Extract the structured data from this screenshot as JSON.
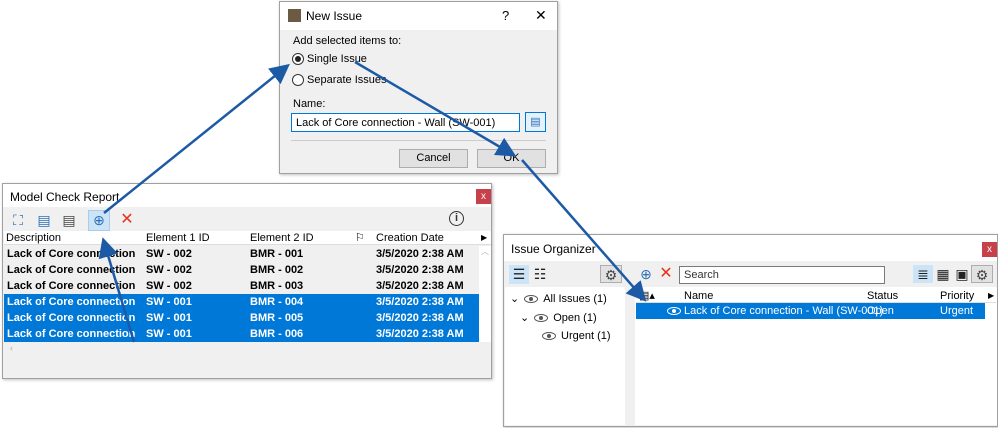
{
  "new_issue": {
    "title": "New Issue",
    "help": "?",
    "close": "✕",
    "prompt": "Add selected items to:",
    "options": [
      "Single Issue",
      "Separate Issues"
    ],
    "selected": "Single Issue",
    "name_label": "Name:",
    "name_value": "Lack of Core connection - Wall (SW-001)",
    "cancel": "Cancel",
    "ok": "OK"
  },
  "report": {
    "title": "Model Check Report",
    "close": "x",
    "info": "i",
    "columns": [
      "Description",
      "Element 1 ID",
      "Element 2 ID",
      "Creation Date"
    ],
    "rows": [
      {
        "d": "Lack of Core connection",
        "e1": "SW - 002",
        "e2": "BMR - 001",
        "date": "3/5/2020 2:38 AM",
        "selected": false
      },
      {
        "d": "Lack of Core connection",
        "e1": "SW - 002",
        "e2": "BMR - 002",
        "date": "3/5/2020 2:38 AM",
        "selected": false
      },
      {
        "d": "Lack of Core connection",
        "e1": "SW - 002",
        "e2": "BMR - 003",
        "date": "3/5/2020 2:38 AM",
        "selected": false
      },
      {
        "d": "Lack of Core connection",
        "e1": "SW - 001",
        "e2": "BMR - 004",
        "date": "3/5/2020 2:38 AM",
        "selected": true
      },
      {
        "d": "Lack of Core connection",
        "e1": "SW - 001",
        "e2": "BMR - 005",
        "date": "3/5/2020 2:38 AM",
        "selected": true
      },
      {
        "d": "Lack of Core connection",
        "e1": "SW - 001",
        "e2": "BMR - 006",
        "date": "3/5/2020 2:38 AM",
        "selected": true
      }
    ]
  },
  "organizer": {
    "title": "Issue Organizer",
    "close": "x",
    "search_placeholder": "Search",
    "tree": [
      "All Issues (1)",
      "Open (1)",
      "Urgent (1)"
    ],
    "columns": [
      "Name",
      "Status",
      "Priority"
    ],
    "rows": [
      {
        "name": "Lack of Core connection - Wall (SW-001)",
        "status": "Open",
        "priority": "Urgent"
      }
    ]
  },
  "colors": {
    "selection": "#0078d7",
    "arrow": "#1d5aa6",
    "delete": "#e8311d"
  }
}
